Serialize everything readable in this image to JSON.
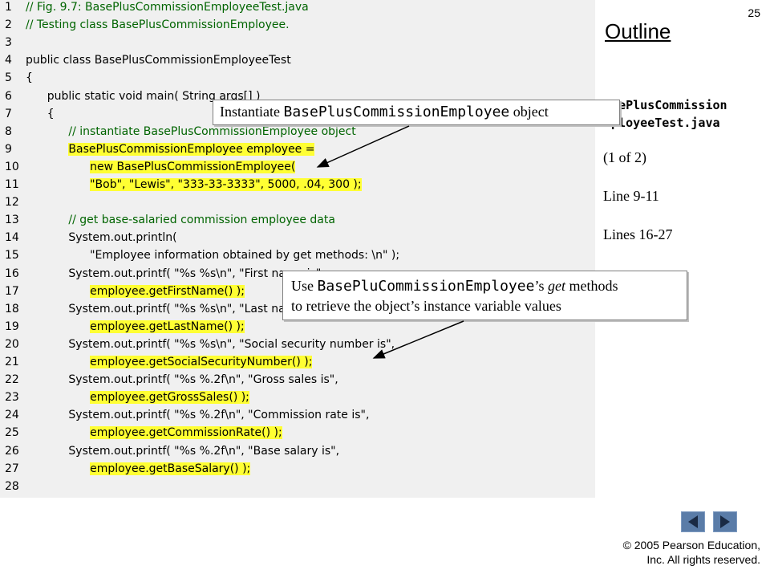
{
  "page_number": "25",
  "outline_title": "Outline",
  "side_panel": {
    "file_name_line1": "BasePlusCommission",
    "file_name_line2": "EmployeeTest.java",
    "page_indicator": "(1 of 2)",
    "line_ref1": "Line 9-11",
    "line_ref2": "Lines 16-27"
  },
  "callout1": {
    "prefix": "Instantiate ",
    "code": "BasePlusCommissionEmployee",
    "suffix": " object"
  },
  "callout2": {
    "prefix": "Use ",
    "code": "BasePluCommissionEmployee",
    "mid": "’s ",
    "italic": "get",
    "suffix": " methods",
    "line2": "to retrieve the object’s instance variable values"
  },
  "code_lines": [
    {
      "n": "1",
      "t": "// Fig. 9.7: BasePlusCommissionEmployeeTest.java"
    },
    {
      "n": "2",
      "t": "// Testing class BasePlusCommissionEmployee."
    },
    {
      "n": "3",
      "t": ""
    },
    {
      "n": "4",
      "t": "public class BasePlusCommissionEmployeeTest"
    },
    {
      "n": "5",
      "t": "{"
    },
    {
      "n": "6",
      "t": "   public static void main( String args[] )"
    },
    {
      "n": "7",
      "t": "   {"
    },
    {
      "n": "8",
      "t": "      // instantiate BasePlusCommissionEmployee object"
    },
    {
      "n": "9",
      "t": "      BasePlusCommissionEmployee employee ="
    },
    {
      "n": "10",
      "t": "         new BasePlusCommissionEmployee("
    },
    {
      "n": "11",
      "t": "         \"Bob\", \"Lewis\", \"333-33-3333\", 5000, .04, 300 );"
    },
    {
      "n": "12",
      "t": ""
    },
    {
      "n": "13",
      "t": "      // get base-salaried commission employee data"
    },
    {
      "n": "14",
      "t": "      System.out.println("
    },
    {
      "n": "15",
      "t": "         \"Employee information obtained by get methods: \\n\" );"
    },
    {
      "n": "16",
      "t": "      System.out.printf( \"%s %s\\n\", \"First name is\","
    },
    {
      "n": "17",
      "t": "         employee.getFirstName() );"
    },
    {
      "n": "18",
      "t": "      System.out.printf( \"%s %s\\n\", \"Last name is\","
    },
    {
      "n": "19",
      "t": "         employee.getLastName() );"
    },
    {
      "n": "20",
      "t": "      System.out.printf( \"%s %s\\n\", \"Social security number is\","
    },
    {
      "n": "21",
      "t": "         employee.getSocialSecurityNumber() );"
    },
    {
      "n": "22",
      "t": "      System.out.printf( \"%s %.2f\\n\", \"Gross sales is\","
    },
    {
      "n": "23",
      "t": "         employee.getGrossSales() );"
    },
    {
      "n": "24",
      "t": "      System.out.printf( \"%s %.2f\\n\", \"Commission rate is\","
    },
    {
      "n": "25",
      "t": "         employee.getCommissionRate() );"
    },
    {
      "n": "26",
      "t": "      System.out.printf( \"%s %.2f\\n\", \"Base salary is\","
    },
    {
      "n": "27",
      "t": "         employee.getBaseSalary() );"
    },
    {
      "n": "28",
      "t": ""
    }
  ],
  "nav": {
    "prev_icon": "triangle-left-icon",
    "next_icon": "triangle-right-icon"
  },
  "copyright_line1": "© 2005 Pearson Education,",
  "copyright_line2": "Inc.  All rights reserved.",
  "colors": {
    "highlight": "#ffff33",
    "code_bg": "#f0f0f0",
    "nav_button": "#5a7ca8"
  }
}
